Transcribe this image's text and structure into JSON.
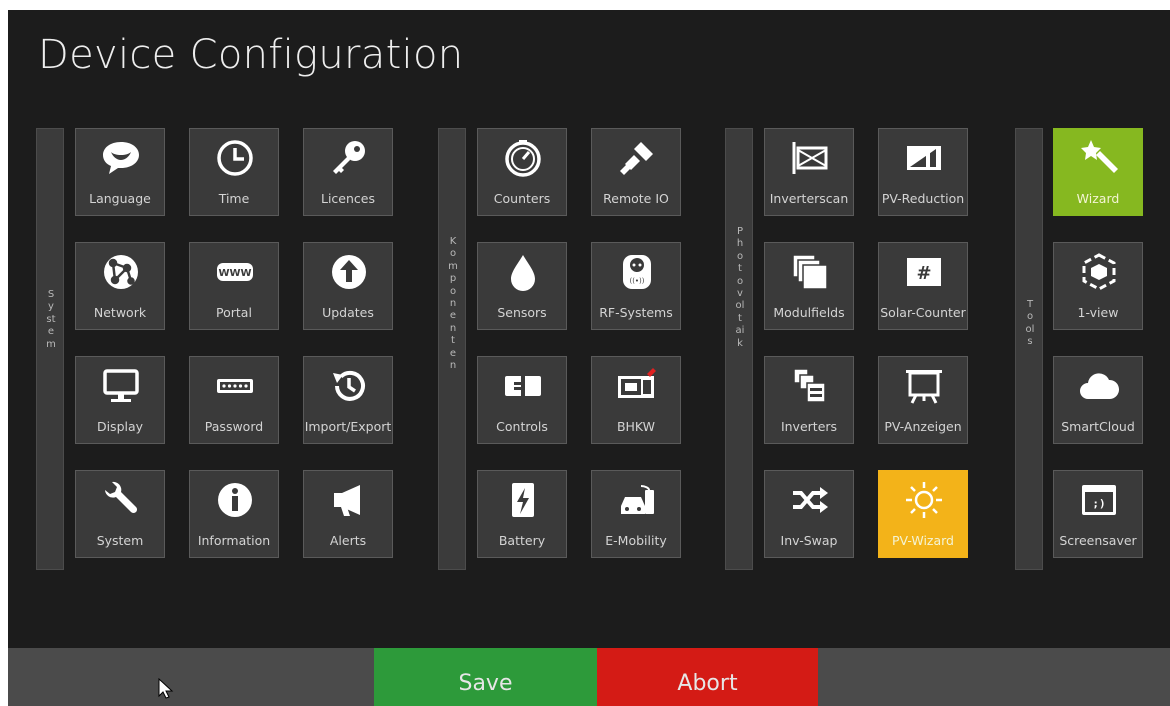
{
  "title": "Device Configuration",
  "groups": [
    {
      "label": "System",
      "items": [
        "Language",
        "Time",
        "Licences",
        "Network",
        "Portal",
        "Updates",
        "Display",
        "Password",
        "Import/Export",
        "System",
        "Information",
        "Alerts"
      ]
    },
    {
      "label": "Komponenten",
      "items": [
        "Counters",
        "Remote IO",
        "Sensors",
        "RF-Systems",
        "Controls",
        "BHKW",
        "Battery",
        "E-Mobility"
      ]
    },
    {
      "label": "Photovoltaik",
      "items": [
        "Inverterscan",
        "PV-Reduction",
        "Modulfields",
        "Solar-Counter",
        "Inverters",
        "PV-Anzeigen",
        "Inv-Swap",
        "PV-Wizard"
      ]
    },
    {
      "label": "Tools",
      "items": [
        "Wizard",
        "1-view",
        "SmartCloud",
        "Screensaver"
      ]
    }
  ],
  "buttons": {
    "save": "Save",
    "abort": "Abort"
  },
  "colors": {
    "background": "#1c1c1c",
    "tile": "#3a3a3a",
    "wizard_active": "#86b820",
    "pv_wizard_active": "#f3b319",
    "save": "#2d9a3a",
    "abort": "#d41b15"
  }
}
